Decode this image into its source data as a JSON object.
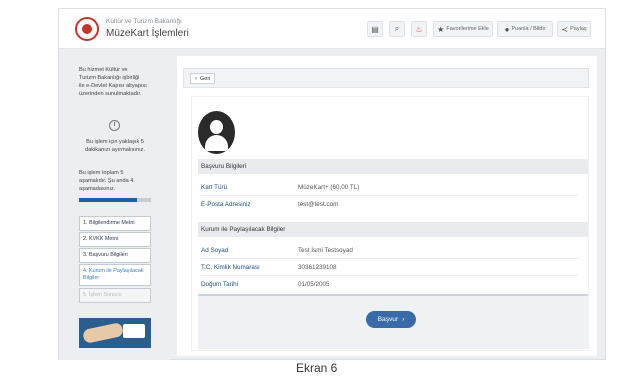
{
  "header": {
    "ministry": "Kültür ve Turizm Bakanlığı",
    "app_name": "MüzeKart İşlemleri",
    "favorites_label": "Favorilerime Ekle",
    "rate_label": "Puanla / Bildir",
    "share_label": "Paylaş",
    "icons": [
      "document-icon",
      "search-icon",
      "fire-icon",
      "star-icon",
      "comment-icon",
      "share-icon"
    ]
  },
  "sidebar": {
    "intro": [
      "Bu hizmet Kültür ve",
      "Turizm Bakanlığı işbirliği",
      "ile e-Devlet Kapısı altyapısı",
      "üzerinden sunulmaktadır."
    ],
    "duration": [
      "Bu işlem için yaklaşık 5",
      "dakikanızı ayırmalısınız."
    ],
    "stage_info": [
      "Bu işlem toplam 5",
      "aşamalıdır. Şu anda 4.",
      "aşamadasınız."
    ],
    "progress": 0.8,
    "steps": [
      {
        "label": "1. Bilgilendirme Metni"
      },
      {
        "label": "2. KVKK Metni"
      },
      {
        "label": "3. Başvuru Bilgileri"
      },
      {
        "label": "4. Kurum ile Paylaşılacak Bilgiler"
      },
      {
        "label": "5. İşlem Sonucu"
      }
    ]
  },
  "main": {
    "back_label": "Geri",
    "section1_title": "Başvuru Bilgileri",
    "card_type_label": "Kart Türü",
    "card_type_value": "MüzeKart+ (60,00 TL)",
    "email_label": "E-Posta Adresiniz",
    "email_value": "test@test.com",
    "section2_title": "Kurum ile Paylaşılacak Bilgiler",
    "name_label": "Ad Soyad",
    "name_value": "Test İsmi Testsoyad",
    "tc_label": "T.C. Kimlik Numarası",
    "tc_value": "30361239108",
    "birth_label": "Doğum Tarihi",
    "birth_value": "01/05/2005",
    "submit_label": "Başvur"
  },
  "caption": "Ekran 6"
}
